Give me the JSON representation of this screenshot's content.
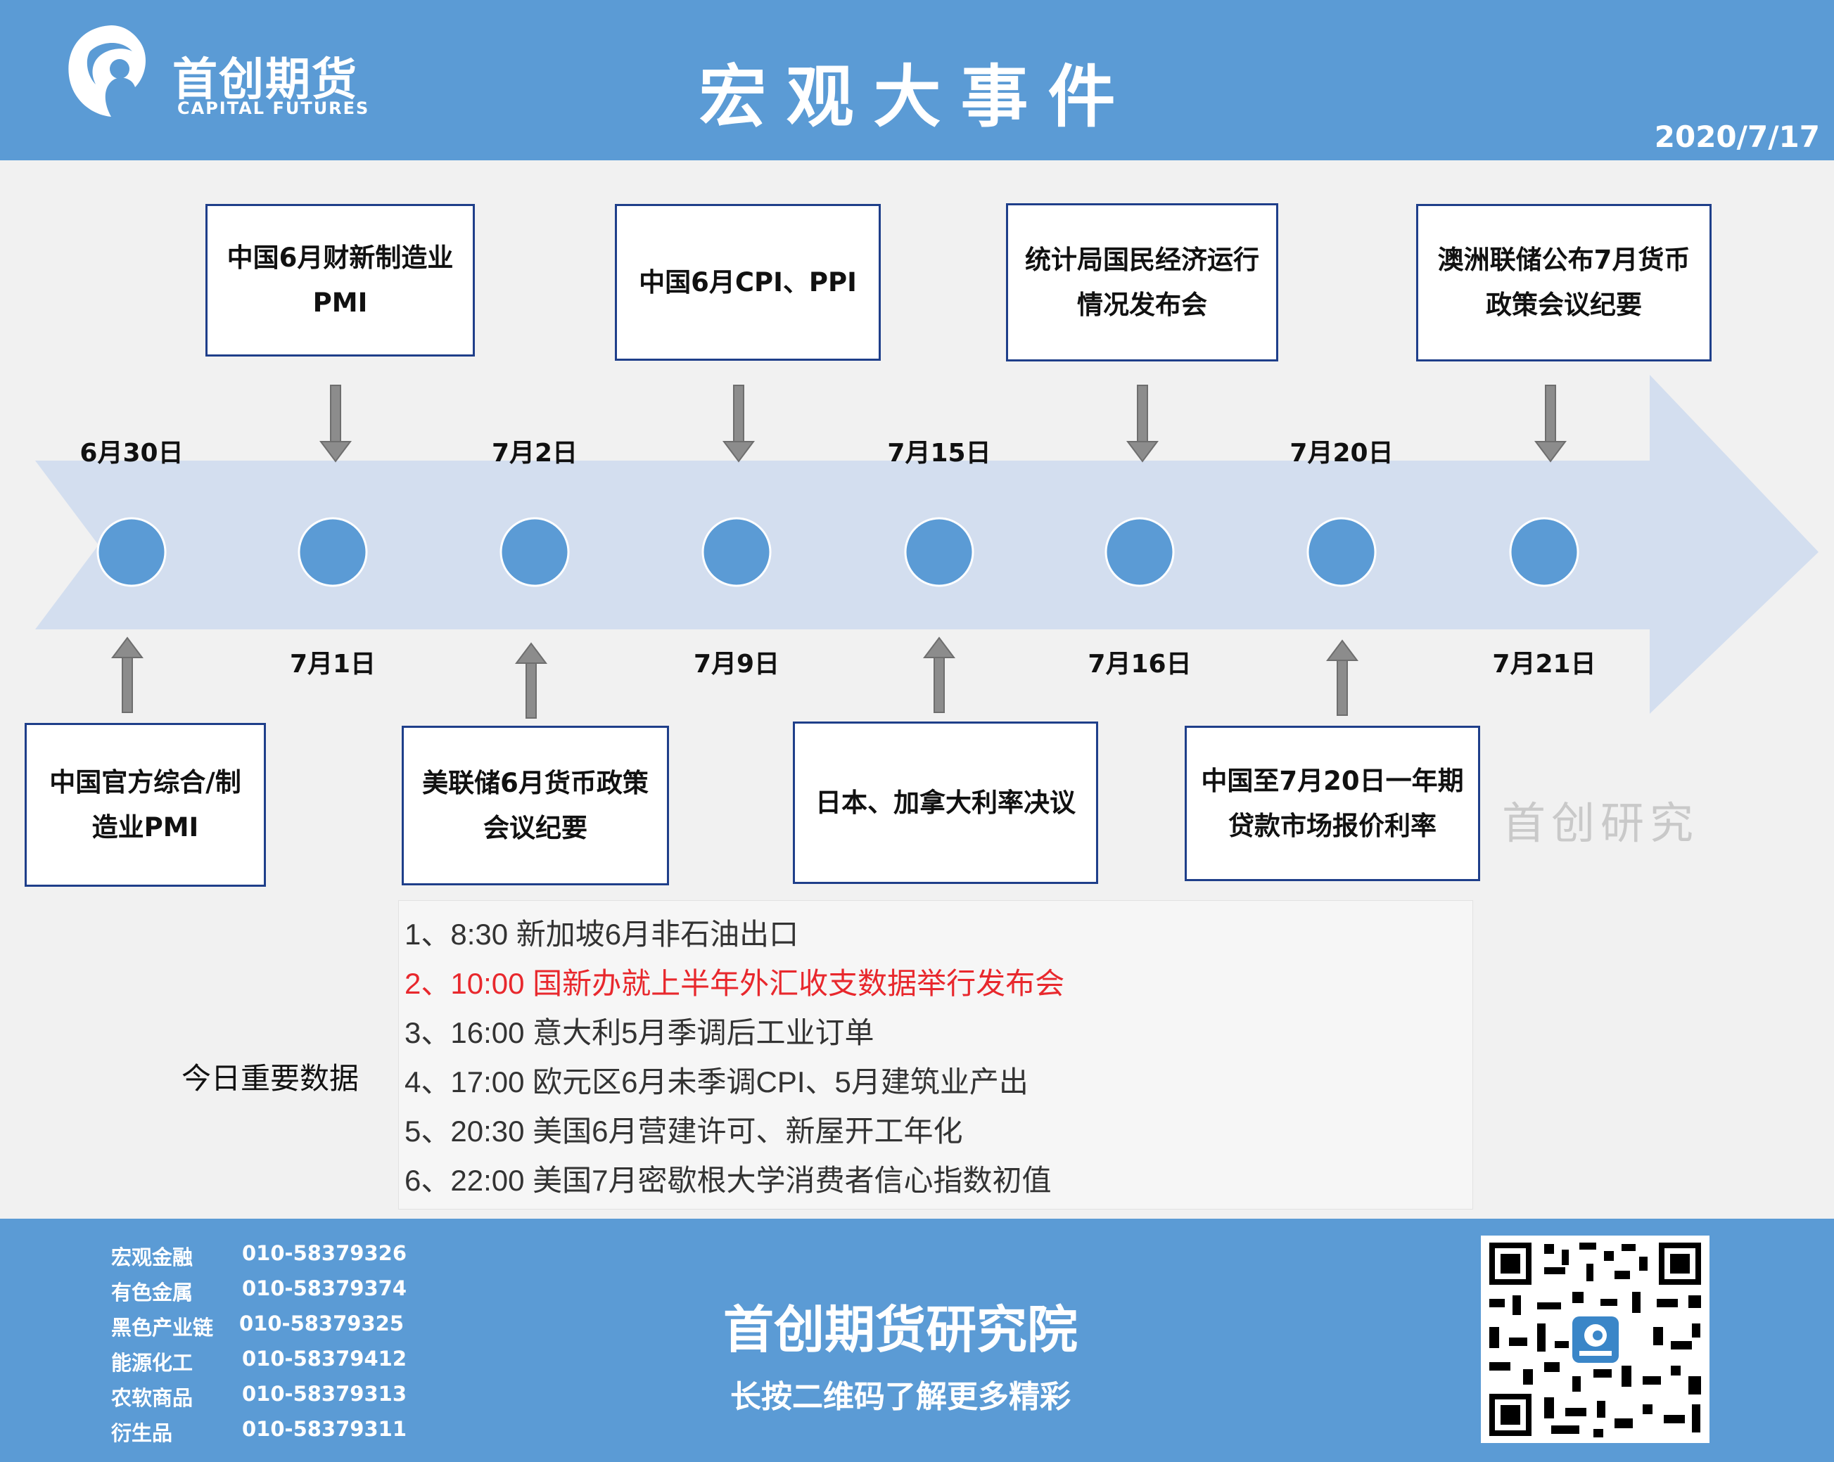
{
  "header": {
    "logo_cn": "首创期货",
    "logo_en": "CAPITAL FUTURES",
    "title": "宏观大事件",
    "date": "2020/7/17"
  },
  "timeline": {
    "dates": [
      "6月30日",
      "7月1日",
      "7月2日",
      "7月9日",
      "7月15日",
      "7月16日",
      "7月20日",
      "7月21日"
    ],
    "top_events": [
      {
        "line1": "中国6月财新制造业",
        "line2": "PMI"
      },
      {
        "line1": "中国6月CPI、PPI",
        "line2": ""
      },
      {
        "line1": "统计局国民经济运行",
        "line2": "情况发布会"
      },
      {
        "line1": "澳洲联储公布7月货币",
        "line2": "政策会议纪要"
      }
    ],
    "bottom_events": [
      {
        "line1": "中国官方综合/制",
        "line2": "造业PMI"
      },
      {
        "line1": "美联储6月货币政策",
        "line2": "会议纪要"
      },
      {
        "line1": "日本、加拿大利率决议",
        "line2": ""
      },
      {
        "line1": "中国至7月20日一年期",
        "line2": "贷款市场报价利率"
      }
    ]
  },
  "important_data": {
    "label": "今日重要数据",
    "items": [
      "1、8:30 新加坡6月非石油出口",
      "2、10:00 国新办就上半年外汇收支数据举行发布会",
      "3、16:00 意大利5月季调后工业订单",
      "4、17:00 欧元区6月未季调CPI、5月建筑业产出",
      "5、20:30 美国6月营建许可、新屋开工年化",
      "6、22:00 美国7月密歇根大学消费者信心指数初值"
    ],
    "highlight_color": "#e8282d"
  },
  "watermark": "首创研究",
  "footer": {
    "contacts": [
      {
        "name": "宏观金融",
        "phone": "010-58379326"
      },
      {
        "name": "有色金属",
        "phone": "010-58379374"
      },
      {
        "name": "黑色产业链",
        "phone": "010-58379325"
      },
      {
        "name": "能源化工",
        "phone": "010-58379412"
      },
      {
        "name": "农软商品",
        "phone": "010-58379313"
      },
      {
        "name": "衍生品",
        "phone": "010-58379311"
      }
    ],
    "title": "首创期货研究院",
    "subtitle": "长按二维码了解更多精彩",
    "qr_icon": "qr-code-icon"
  },
  "colors": {
    "brand_blue": "#5b9bd5",
    "arrow_fill": "#d3deef",
    "node_fill": "#5b9bd5",
    "box_border": "#1f3f8a"
  }
}
